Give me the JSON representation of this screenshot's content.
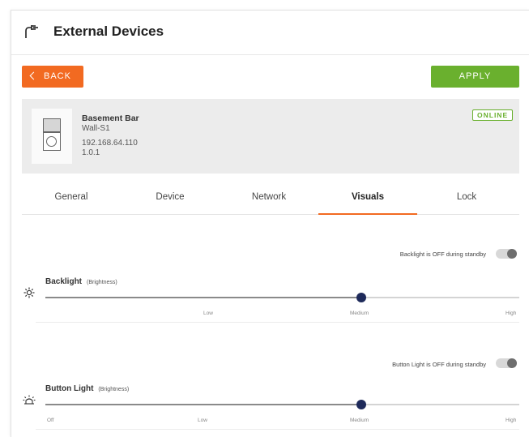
{
  "header": {
    "title": "External Devices",
    "icon": "device-plug-icon"
  },
  "toolbar": {
    "back_label": "BACK",
    "apply_label": "APPLY"
  },
  "device": {
    "name": "Basement Bar",
    "model": "Wall-S1",
    "ip": "192.168.64.110",
    "version": "1.0.1",
    "status": "ONLINE"
  },
  "tabs": [
    {
      "label": "General"
    },
    {
      "label": "Device"
    },
    {
      "label": "Network"
    },
    {
      "label": "Visuals",
      "active": true
    },
    {
      "label": "Lock"
    }
  ],
  "backlight": {
    "standby_text": "Backlight is OFF during standby",
    "standby_on": false,
    "title": "Backlight",
    "subtitle": "(Brightness)",
    "icon": "sun-icon",
    "ticks": [
      "Low",
      "Medium",
      "High"
    ],
    "value": "Medium"
  },
  "button_light": {
    "standby_text": "Button Light is OFF during standby",
    "standby_on": false,
    "title": "Button Light",
    "subtitle": "(Brightness)",
    "icon": "light-icon",
    "ticks": [
      "Off",
      "Low",
      "Medium",
      "High"
    ],
    "value": "Medium"
  },
  "colors": {
    "accent": "#f26a21",
    "apply": "#6ab02e",
    "online": "#6ab02e",
    "slider_thumb": "#1e2a5a"
  }
}
